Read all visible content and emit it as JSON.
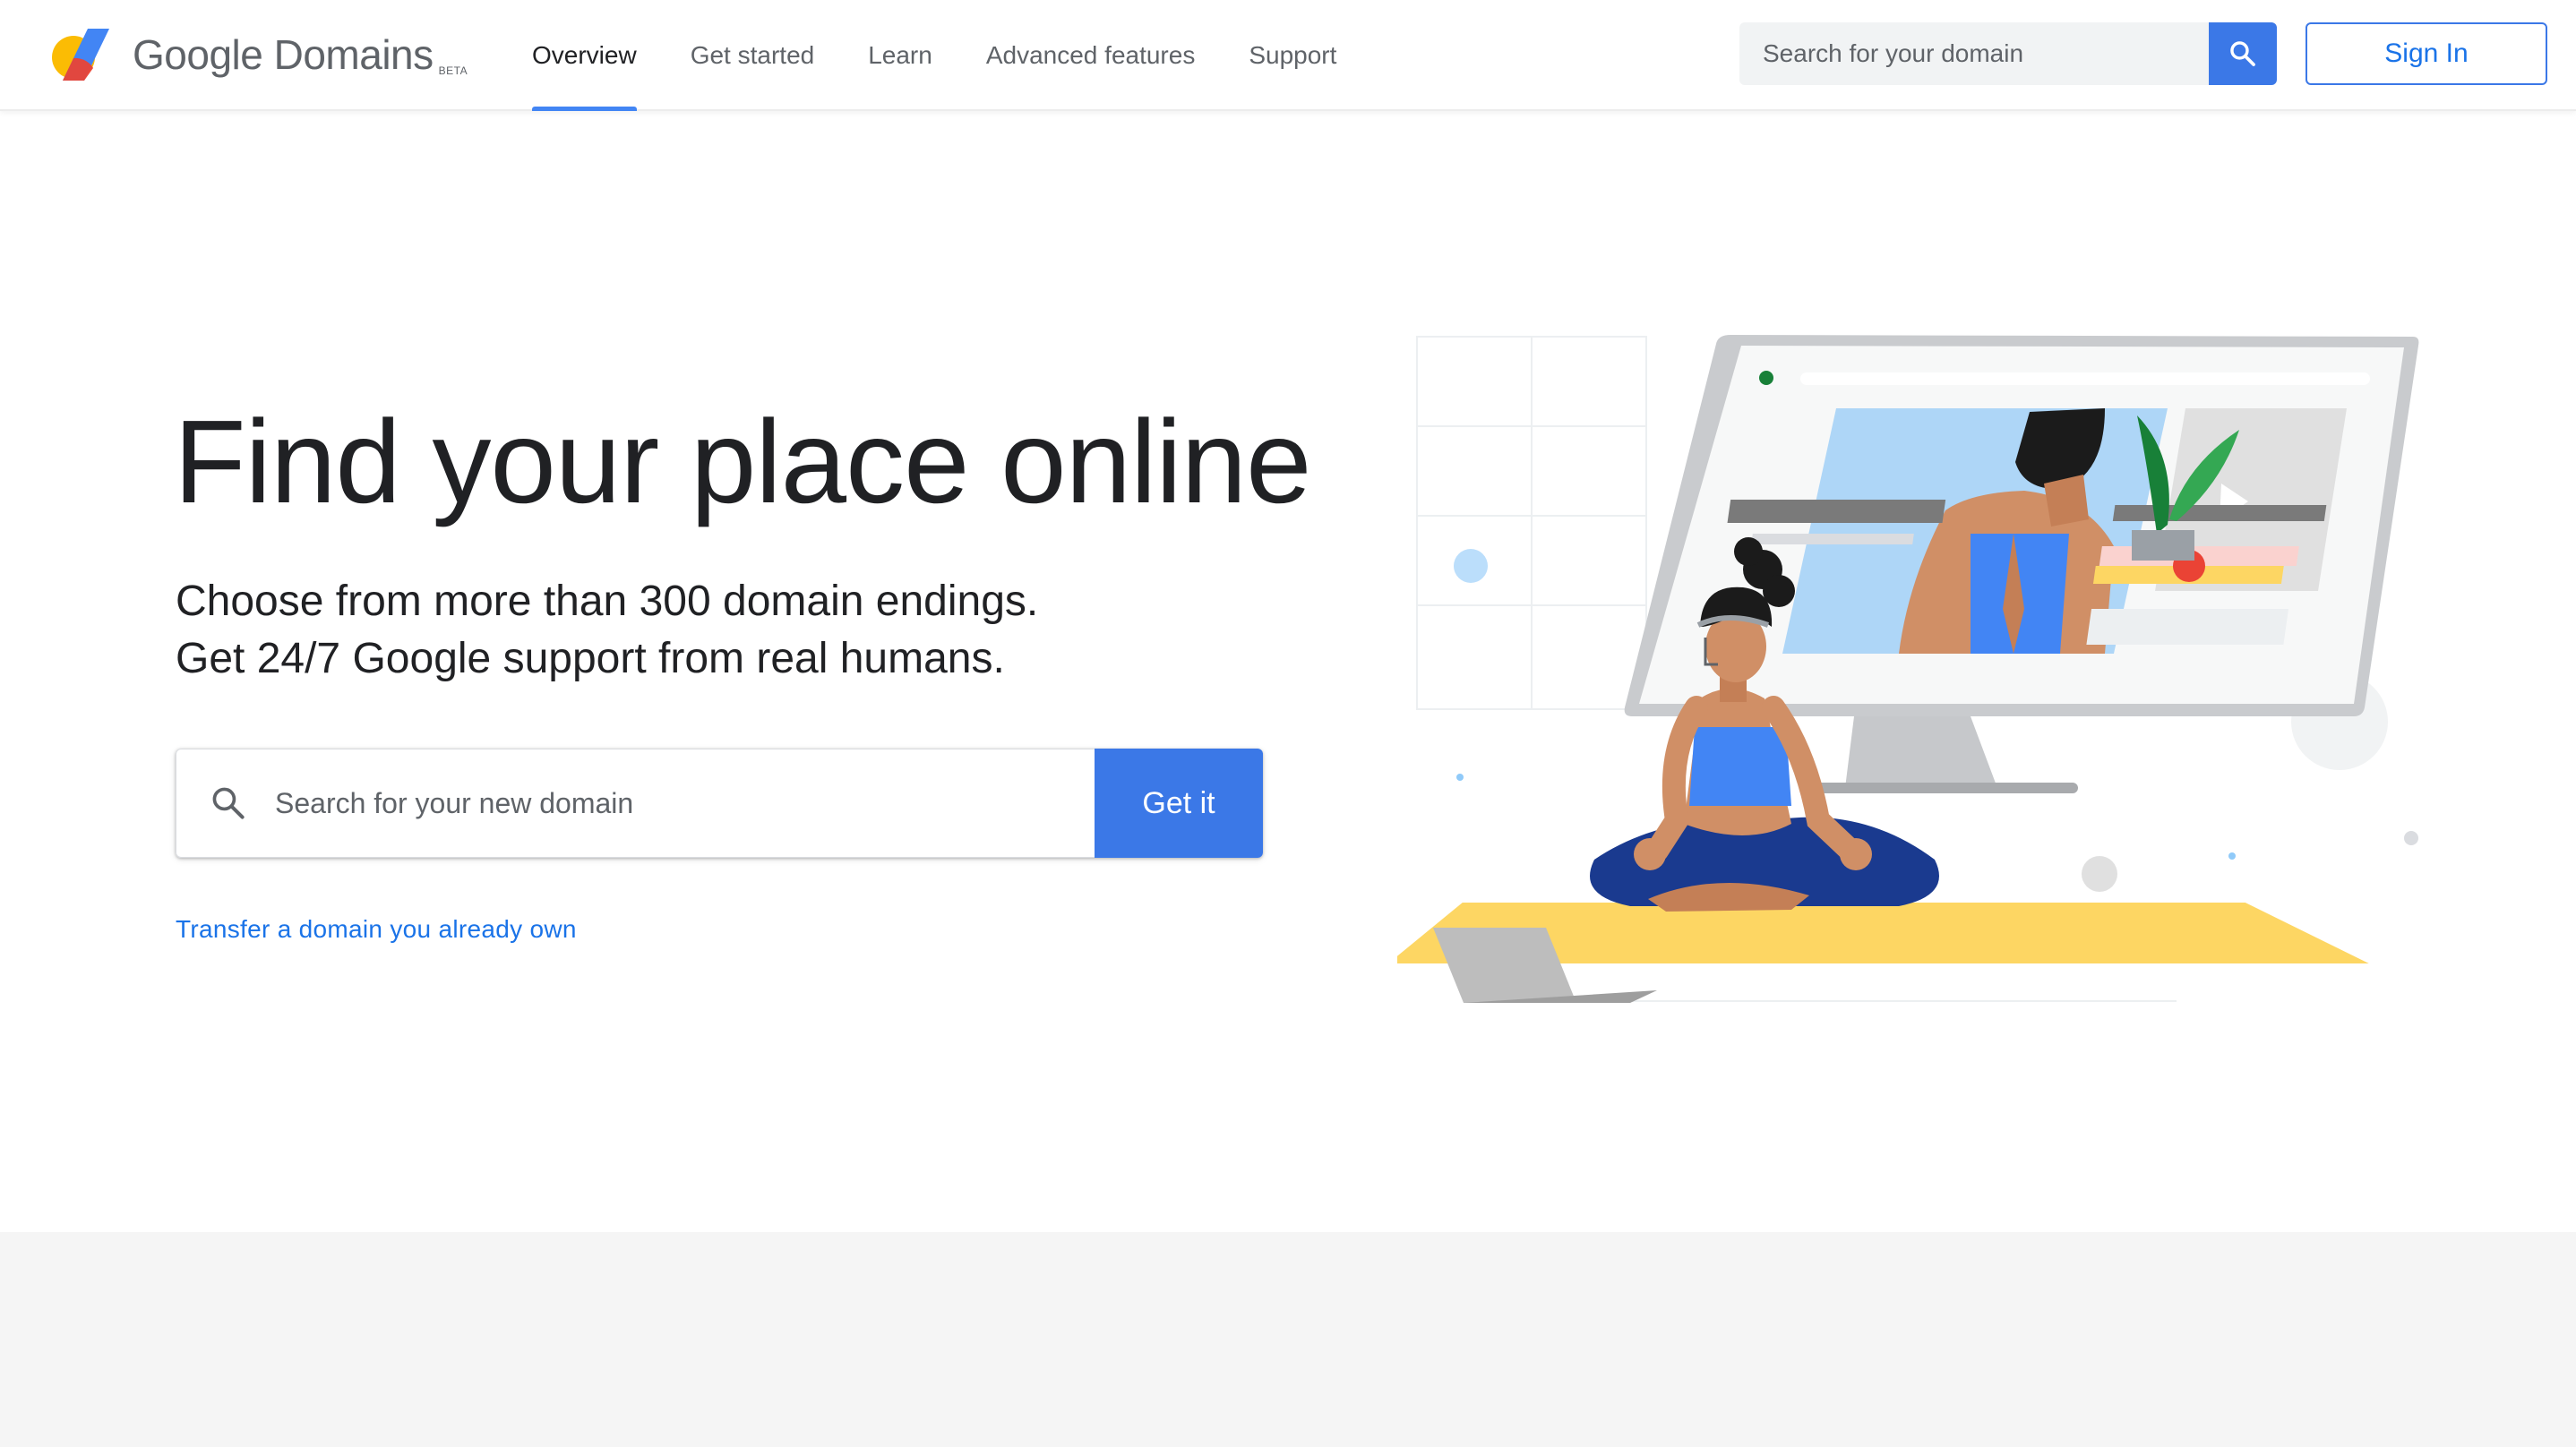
{
  "header": {
    "logo_text": "Google Domains",
    "logo_badge": "BETA",
    "nav": [
      {
        "label": "Overview",
        "active": true
      },
      {
        "label": "Get started",
        "active": false
      },
      {
        "label": "Learn",
        "active": false
      },
      {
        "label": "Advanced features",
        "active": false
      },
      {
        "label": "Support",
        "active": false
      }
    ],
    "search_placeholder": "Search for your domain",
    "search_icon": "search-icon",
    "signin_label": "Sign In"
  },
  "hero": {
    "title": "Find your place online",
    "subtitle_line1": "Choose from more than 300 domain endings.",
    "subtitle_line2": "Get 24/7 Google support from real humans.",
    "search_placeholder": "Search for your new domain",
    "search_icon": "search-icon",
    "cta_label": "Get it",
    "transfer_link": "Transfer a domain you already own"
  },
  "illustration": {
    "subject": "yoga-video-call-illustration"
  },
  "colors": {
    "accent": "#3b78e7",
    "link": "#1a73e8",
    "text": "#202124",
    "muted": "#5f6368",
    "band": "#f5f5f5"
  }
}
